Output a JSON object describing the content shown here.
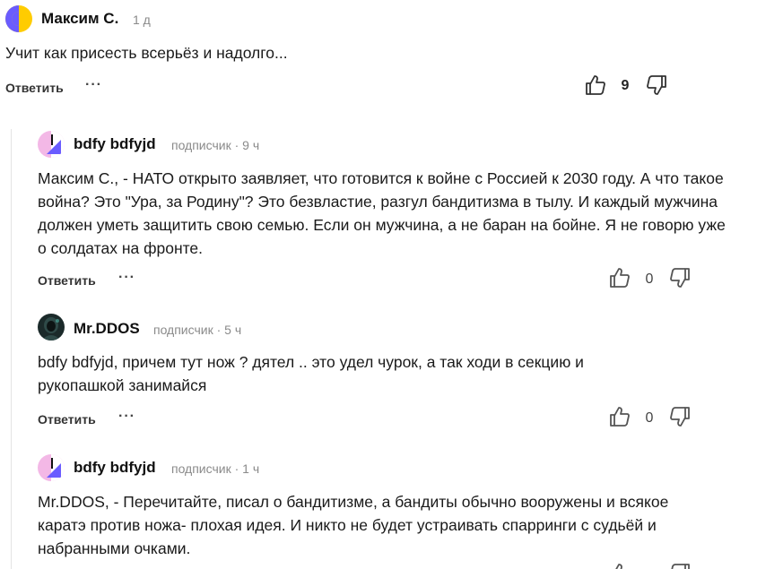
{
  "comments": [
    {
      "author": "Максим С.",
      "meta": "1 д",
      "text": "Учит как присесть всерьёз и надолго...",
      "reply_label": "Ответить",
      "more": "···",
      "likes": "9"
    },
    {
      "author": "bdfy bdfyjd",
      "meta": "подписчик · 9 ч",
      "text": "Максим С., - НАТО открыто заявляет, что готовится к войне с Россией к 2030 году. А что такое война? Это \"Ура, за Родину\"? Это безвластие, разгул бандитизма в тылу. И каждый мужчина должен уметь защитить свою семью. Если он мужчина, а не баран на бойне. Я не говорю уже о солдатах на фронте.",
      "reply_label": "Ответить",
      "more": "···",
      "likes": "0"
    },
    {
      "author": "Mr.DDOS",
      "meta": "подписчик · 5 ч",
      "text": "bdfy bdfyjd, причем тут нож ? дятел .. это удел чурок, а так ходи в секцию и рукопашкой занимайся",
      "reply_label": "Ответить",
      "more": "···",
      "likes": "0"
    },
    {
      "author": "bdfy bdfyjd",
      "meta": "подписчик · 1 ч",
      "text": "Mr.DDOS, - Перечитайте,  писал о бандитизме, а бандиты обычно вооружены и всякое каратэ против ножа- плохая идея. И никто не будет устраивать спарринги с судьёй и набранными очками."
    }
  ],
  "icons": {
    "like": "thumb-up-icon",
    "dislike": "thumb-down-icon"
  },
  "colors": {
    "avatar_yellow": "#ffcc00",
    "avatar_purple": "#6a5cff",
    "avatar_pink": "#f3b8e6",
    "meta_gray": "#8a8a8a"
  }
}
